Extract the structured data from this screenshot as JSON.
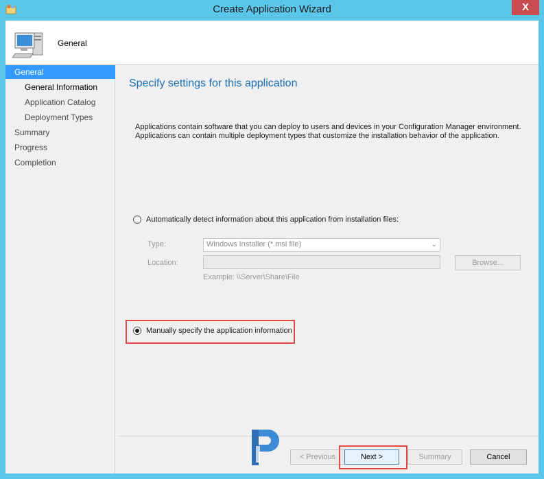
{
  "window": {
    "title": "Create Application Wizard",
    "close_glyph": "X"
  },
  "header": {
    "title": "General",
    "icon": "computer-icon"
  },
  "nav": {
    "items": [
      {
        "label": "General",
        "selected": true
      },
      {
        "label": "General Information",
        "sub": true,
        "current": true
      },
      {
        "label": "Application Catalog",
        "sub": true
      },
      {
        "label": "Deployment Types",
        "sub": true
      },
      {
        "label": "Summary"
      },
      {
        "label": "Progress"
      },
      {
        "label": "Completion"
      }
    ]
  },
  "content": {
    "title": "Specify settings for this application",
    "description": "Applications contain software that you can deploy to users and devices in your Configuration Manager environment. Applications can contain multiple deployment types that customize the installation behavior of the application.",
    "auto_detect_label": "Automatically detect information about this application from installation files:",
    "type_label": "Type:",
    "type_value": "Windows Installer (*.msi file)",
    "location_label": "Location:",
    "location_value": "",
    "browse_label": "Browse...",
    "example_text": "Example: \\\\Server\\Share\\File",
    "manual_label": "Manually specify the application information",
    "selected_option": "manual"
  },
  "footer": {
    "previous_label": "< Previous",
    "next_label": "Next >",
    "summary_label": "Summary",
    "cancel_label": "Cancel"
  },
  "colors": {
    "title_bar": "#59c6ea",
    "accent": "#3399ff",
    "title_blue": "#1d6fb8",
    "highlight": "#e04a4a",
    "close": "#c74b50"
  }
}
